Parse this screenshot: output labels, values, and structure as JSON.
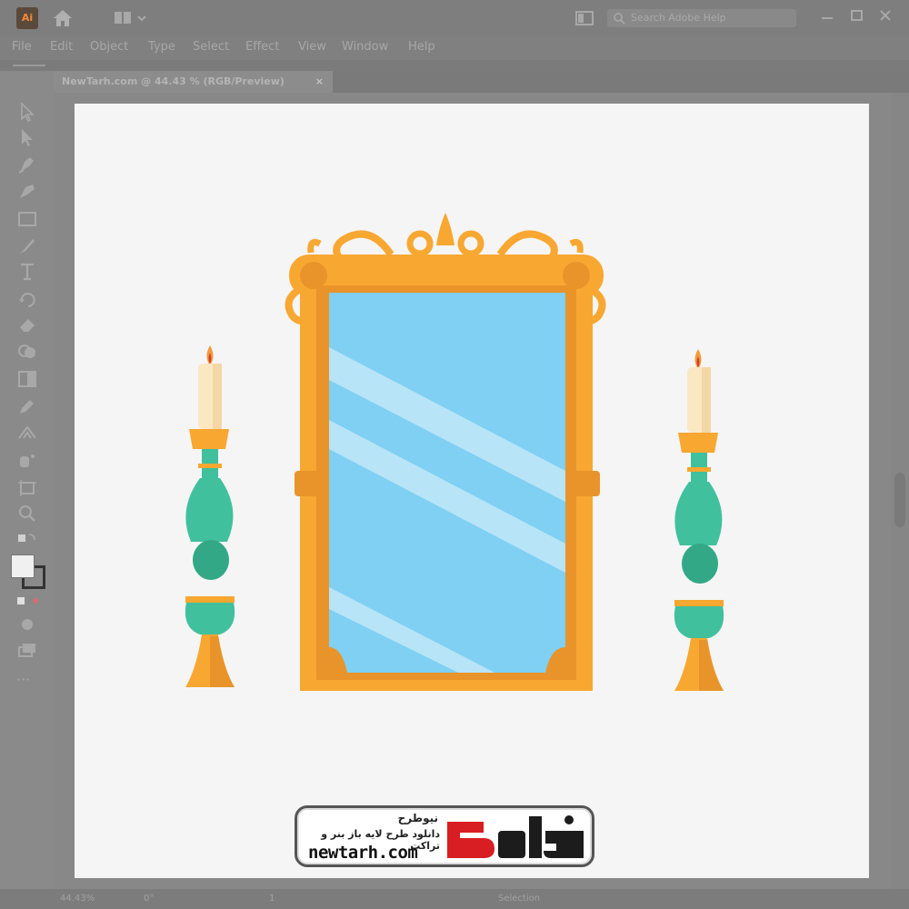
{
  "app": {
    "icon_text": "Ai"
  },
  "search": {
    "placeholder": "Search Adobe Help"
  },
  "menu": [
    "File",
    "Edit",
    "Object",
    "Type",
    "Select",
    "Effect",
    "View",
    "Window",
    "Help"
  ],
  "document_tab": {
    "title": "NewTarh.com @ 44.43 % (RGB/Preview)",
    "close": "×"
  },
  "status": {
    "zoom": "44.43%",
    "rotate": "0°",
    "artboard": "1",
    "tool": "Selection"
  },
  "watermark": {
    "title_fa": "نیوطرح",
    "subtitle_fa": "دانلود طرح لایه باز بنر و تراکت",
    "url": "newtarh.com",
    "brand_fa": "نیوطرح"
  },
  "colors": {
    "frame": "#F8A731",
    "frame_dark": "#E8942A",
    "glass": "#7FD0F2",
    "glass_shine": "#B8E4F8",
    "candle": "#FBE7C2",
    "holder": "#40C09C",
    "holder_dark": "#32A886",
    "logo_red": "#D81E22"
  },
  "icons": [
    "home-icon",
    "workspace-icon",
    "panel-icon",
    "search-icon",
    "minimize-icon",
    "maximize-icon",
    "close-icon",
    "selection-tool-icon",
    "direct-selection-icon",
    "pen-tool-icon",
    "curvature-icon",
    "rectangle-icon",
    "brush-icon",
    "type-icon",
    "rotate-icon",
    "eraser-icon",
    "shape-builder-icon",
    "gradient-icon",
    "eyedropper-icon",
    "blend-icon",
    "symbol-sprayer-icon",
    "artboard-icon",
    "zoom-icon"
  ]
}
